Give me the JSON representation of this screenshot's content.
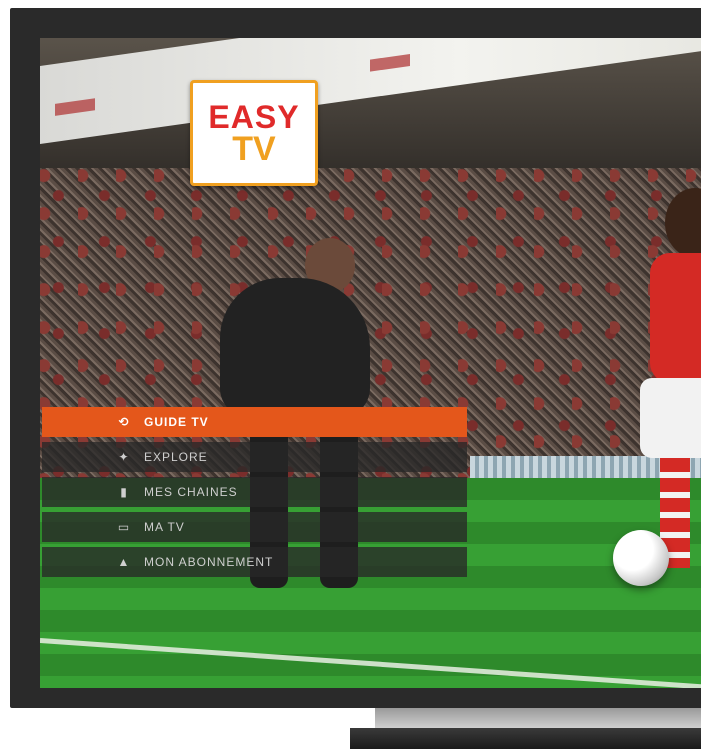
{
  "logo": {
    "line1": "EASY",
    "line2": "TV"
  },
  "menu": {
    "items": [
      {
        "label": "GUIDE TV",
        "icon": "tv-guide-icon",
        "glyph": "⟲",
        "active": true
      },
      {
        "label": "EXPLORE",
        "icon": "explore-icon",
        "glyph": "✦",
        "active": false
      },
      {
        "label": "MES CHAINES",
        "icon": "channels-icon",
        "glyph": "▮",
        "active": false
      },
      {
        "label": "MA TV",
        "icon": "my-tv-icon",
        "glyph": "▭",
        "active": false
      },
      {
        "label": "MON ABONNEMENT",
        "icon": "subscription-icon",
        "glyph": "▲",
        "active": false
      }
    ]
  },
  "colors": {
    "accent": "#e4571b",
    "logo_red": "#e02a2a",
    "logo_orange": "#f0a020"
  }
}
